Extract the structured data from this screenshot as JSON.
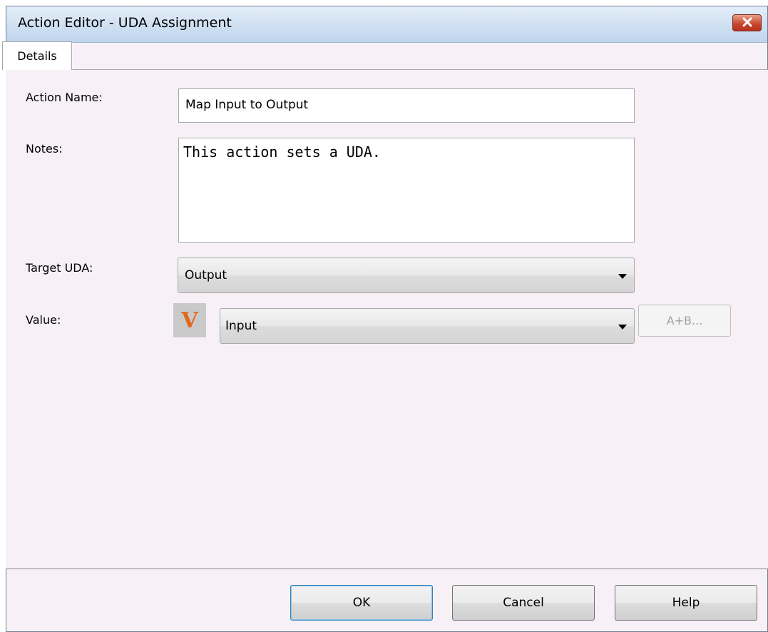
{
  "window": {
    "title": "Action Editor - UDA Assignment"
  },
  "tabs": [
    {
      "label": "Details"
    }
  ],
  "form": {
    "action_name_label": "Action Name:",
    "action_name_value": "Map Input to Output",
    "notes_label": "Notes:",
    "notes_value": "This action sets a UDA.",
    "target_uda_label": "Target UDA:",
    "target_uda_value": "Output",
    "value_label": "Value:",
    "value_type_icon_glyph": "V",
    "value_selected": "Input",
    "expression_button_label": "A+B..."
  },
  "buttons": {
    "ok": "OK",
    "cancel": "Cancel",
    "help": "Help"
  },
  "colors": {
    "value_icon": "#e0681a",
    "close_button": "#c7432b",
    "titlebar": "#cfe0f2"
  },
  "icons": {
    "close": "close-icon",
    "dropdown": "chevron-down-icon",
    "value_type": "variable-icon"
  }
}
